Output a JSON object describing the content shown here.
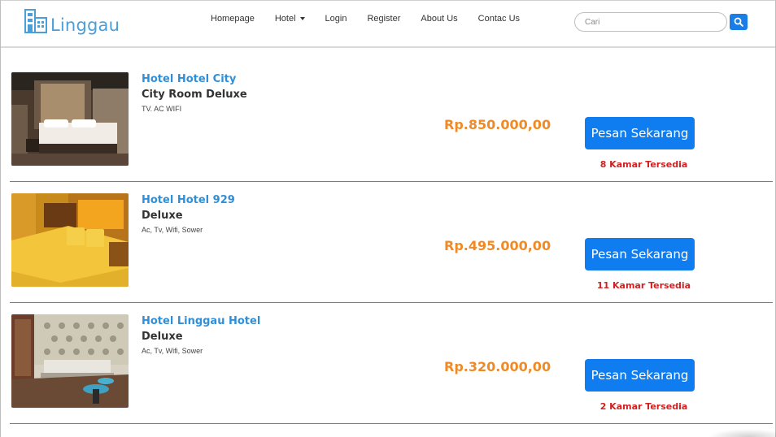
{
  "brand": {
    "name": "Linggau",
    "icon": "building-icon"
  },
  "nav": {
    "items": [
      {
        "label": "Homepage"
      },
      {
        "label": "Hotel",
        "dropdown": true
      },
      {
        "label": "Login"
      },
      {
        "label": "Register"
      },
      {
        "label": "About Us"
      },
      {
        "label": "Contac Us"
      }
    ]
  },
  "search": {
    "placeholder": "Cari",
    "value": "",
    "button_icon": "search-icon"
  },
  "rooms": [
    {
      "hotel": "Hotel Hotel City",
      "type": "City Room Deluxe",
      "facilities": "TV. AC WIFI",
      "price": "Rp.850.000,00",
      "button": "Pesan Sekarang",
      "availability": "8 Kamar Tersedia"
    },
    {
      "hotel": "Hotel Hotel 929",
      "type": "Deluxe",
      "facilities": "Ac, Tv, Wifi, Sower",
      "price": "Rp.495.000,00",
      "button": "Pesan Sekarang",
      "availability": "11 Kamar Tersedia"
    },
    {
      "hotel": "Hotel Linggau Hotel",
      "type": "Deluxe",
      "facilities": "Ac, Tv, Wifi, Sower",
      "price": "Rp.320.000,00",
      "button": "Pesan Sekarang",
      "availability": "2 Kamar Tersedia"
    }
  ],
  "colors": {
    "brand": "#4a9fd8",
    "hotel_name": "#2f8fd8",
    "price": "#f08a24",
    "button": "#0f7df0",
    "availability": "#d32020"
  }
}
